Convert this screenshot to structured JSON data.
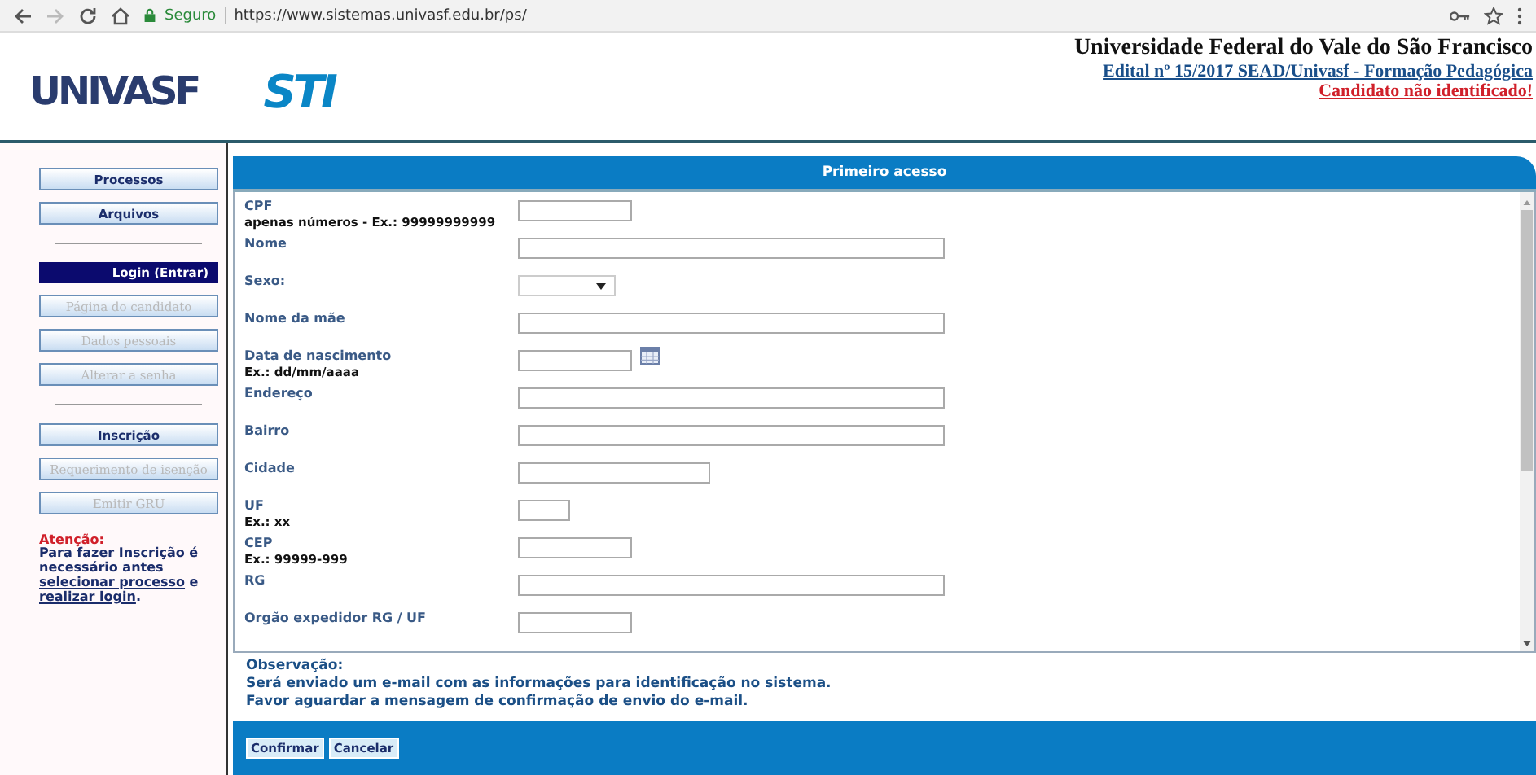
{
  "browser": {
    "security": "Seguro",
    "url": "https://www.sistemas.univasf.edu.br/ps/"
  },
  "header": {
    "logos": [
      "UNIVASF",
      "STI"
    ],
    "title": "Universidade Federal do Vale do São Francisco",
    "notice_link": "Edital nº 15/2017 SEAD/Univasf - Formação Pedagógica",
    "status": "Candidato não identificado!"
  },
  "sidebar": {
    "items": [
      {
        "kind": "button",
        "label": "Processos",
        "selected": false,
        "disabled": false
      },
      {
        "kind": "button",
        "label": "Arquivos",
        "selected": false,
        "disabled": false
      },
      {
        "kind": "divider"
      },
      {
        "kind": "button",
        "label": "Login (Entrar)",
        "selected": true,
        "disabled": false
      },
      {
        "kind": "button",
        "label": "Página do candidato",
        "selected": false,
        "disabled": true
      },
      {
        "kind": "button",
        "label": "Dados pessoais",
        "selected": false,
        "disabled": true
      },
      {
        "kind": "button",
        "label": "Alterar a senha",
        "selected": false,
        "disabled": true
      },
      {
        "kind": "divider"
      },
      {
        "kind": "button",
        "label": "Inscrição",
        "selected": false,
        "disabled": false
      },
      {
        "kind": "button",
        "label": "Requerimento de isenção",
        "selected": false,
        "disabled": true
      },
      {
        "kind": "button",
        "label": "Emitir GRU",
        "selected": false,
        "disabled": true
      }
    ],
    "warning": {
      "title": "Atenção:",
      "parts": [
        {
          "text": "Para fazer Inscrição é necessário antes ",
          "link": false
        },
        {
          "text": "selecionar processo",
          "link": true
        },
        {
          "text": " e ",
          "link": false
        },
        {
          "text": "realizar login",
          "link": true
        },
        {
          "text": ".",
          "link": false
        }
      ]
    }
  },
  "panel": {
    "title": "Primeiro acesso",
    "fields": [
      {
        "label": "CPF",
        "hint": "apenas números - Ex.: 99999999999",
        "kind": "short"
      },
      {
        "label": "Nome",
        "kind": "long"
      },
      {
        "label": "Sexo:",
        "kind": "select"
      },
      {
        "label": "Nome da mãe",
        "kind": "long"
      },
      {
        "label": "Data de nascimento",
        "hint": "Ex.: dd/mm/aaaa",
        "kind": "date"
      },
      {
        "label": "Endereço",
        "kind": "long"
      },
      {
        "label": "Bairro",
        "kind": "long"
      },
      {
        "label": "Cidade",
        "kind": "medium"
      },
      {
        "label": "UF",
        "hint": "Ex.: xx",
        "kind": "tiny"
      },
      {
        "label": "CEP",
        "hint": "Ex.: 99999-999",
        "kind": "short"
      },
      {
        "label": "RG",
        "kind": "long"
      },
      {
        "label": "Orgão expedidor RG / UF",
        "kind": "short"
      }
    ],
    "observation": {
      "title": "Observação:",
      "lines": [
        "Será enviado um e-mail com as informações para identificação no sistema.",
        "Favor aguardar a mensagem de confirmação de envio do e-mail."
      ]
    },
    "buttons": [
      "Confirmar",
      "Cancelar"
    ]
  }
}
